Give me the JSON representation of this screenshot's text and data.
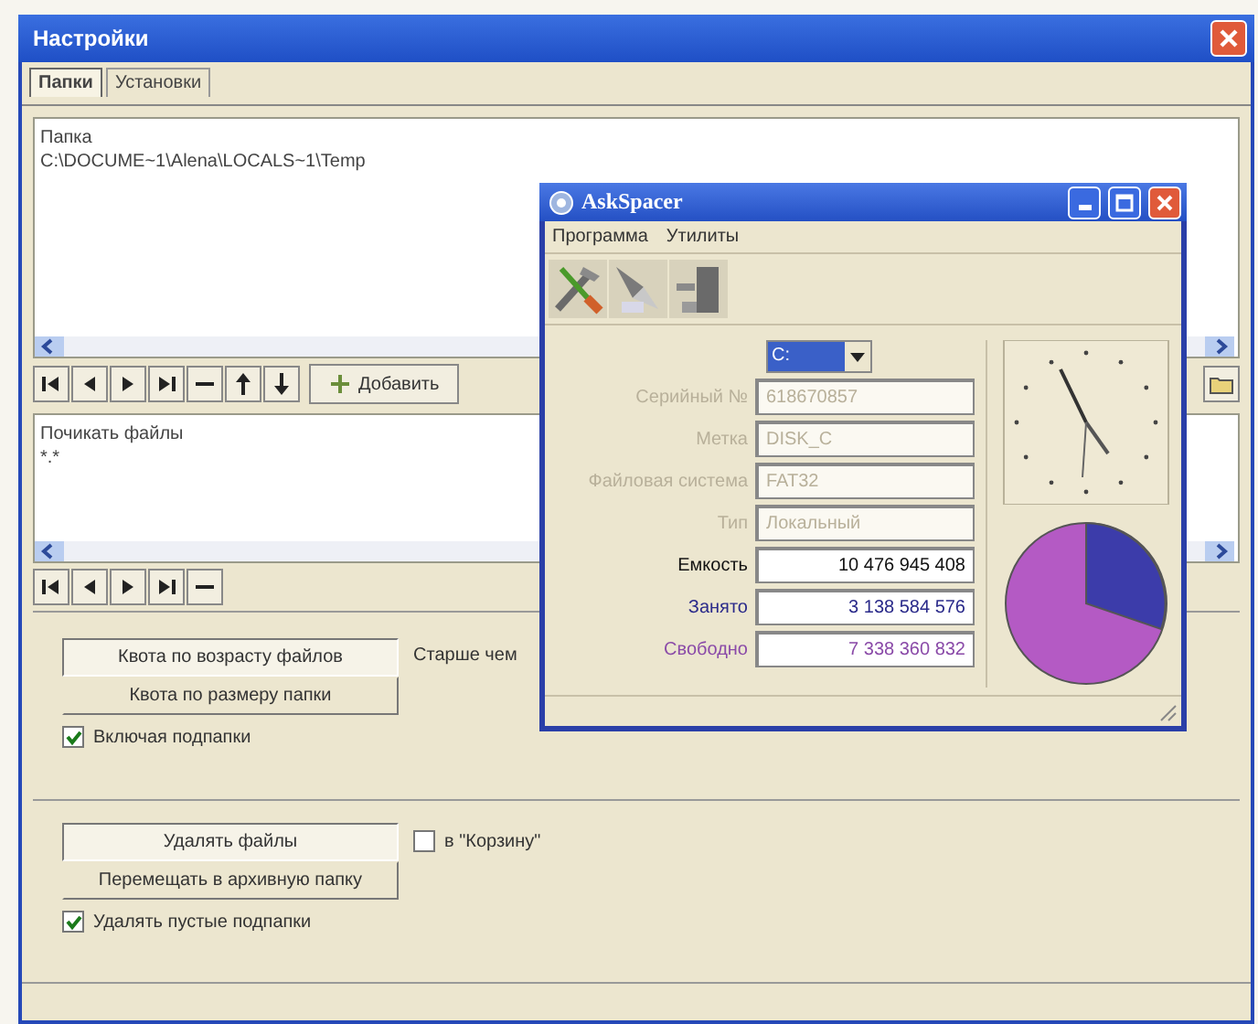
{
  "window": {
    "title": "Настройки"
  },
  "tabs": [
    {
      "label": "Папки",
      "selected": true
    },
    {
      "label": "Установки",
      "selected": false
    }
  ],
  "folder_list": {
    "header": "Папка",
    "items": [
      "C:\\DOCUME~1\\Alena\\LOCALS~1\\Temp"
    ]
  },
  "folder_toolbar": {
    "add_button": "Добавить"
  },
  "skip_list": {
    "header": "Почикать файлы",
    "items": [
      "*.*"
    ]
  },
  "quota_buttons": [
    {
      "label": "Квота по возрасту файлов",
      "selected": true
    },
    {
      "label": "Квота по размеру папки",
      "selected": false
    }
  ],
  "older_than_label": "Старше чем",
  "include_subfolders": {
    "label": "Включая подпапки",
    "checked": true
  },
  "action_buttons": [
    {
      "label": "Удалять файлы",
      "selected": true
    },
    {
      "label": "Перемещать в архивную папку",
      "selected": false
    }
  ],
  "recycle_bin": {
    "label": "в \"Корзину\"",
    "checked": false
  },
  "delete_empty": {
    "label": "Удалять пустые подпапки",
    "checked": true
  },
  "askspacer": {
    "title": "AskSpacer",
    "menu": [
      "Программа",
      "Утилиты"
    ],
    "drive": "C:",
    "fields": [
      {
        "label": "Серийный №",
        "value": "618670857",
        "kind": "info"
      },
      {
        "label": "Метка",
        "value": "DISK_C",
        "kind": "info"
      },
      {
        "label": "Файловая система",
        "value": "FAT32",
        "kind": "info"
      },
      {
        "label": "Тип",
        "value": "Локальный",
        "kind": "info"
      },
      {
        "label": "Емкость",
        "value": "10 476 945 408",
        "kind": "total"
      },
      {
        "label": "Занято",
        "value": "3 138 584 576",
        "kind": "used"
      },
      {
        "label": "Свободно",
        "value": "7 338 360 832",
        "kind": "free"
      }
    ]
  }
}
